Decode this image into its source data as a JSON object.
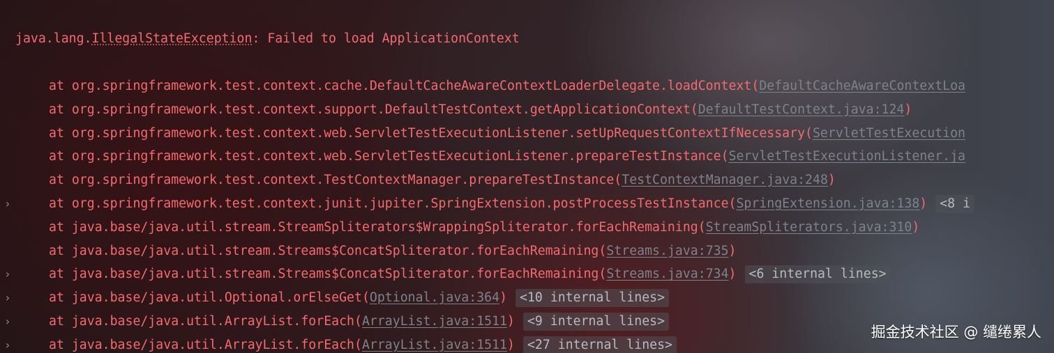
{
  "exception": {
    "class": "java.lang.",
    "class_link": "IllegalStateException",
    "message": ": Failed to load ApplicationContext"
  },
  "frames": [
    {
      "method": "at org.springframework.test.context.cache.DefaultCacheAwareContextLoaderDelegate.loadContext(",
      "link": "DefaultCacheAwareContextLoa",
      "close": "",
      "internal": ""
    },
    {
      "method": "at org.springframework.test.context.support.DefaultTestContext.getApplicationContext(",
      "link": "DefaultTestContext.java:124",
      "close": ")",
      "internal": ""
    },
    {
      "method": "at org.springframework.test.context.web.ServletTestExecutionListener.setUpRequestContextIfNecessary(",
      "link": "ServletTestExecution",
      "close": "",
      "internal": ""
    },
    {
      "method": "at org.springframework.test.context.web.ServletTestExecutionListener.prepareTestInstance(",
      "link": "ServletTestExecutionListener.ja",
      "close": "",
      "internal": ""
    },
    {
      "method": "at org.springframework.test.context.TestContextManager.prepareTestInstance(",
      "link": "TestContextManager.java:248",
      "close": ")",
      "internal": ""
    },
    {
      "method": "at org.springframework.test.context.junit.jupiter.SpringExtension.postProcessTestInstance(",
      "link": "SpringExtension.java:138",
      "close": ")",
      "internal": "<8 i"
    },
    {
      "method": "at java.base/java.util.stream.StreamSpliterators$WrappingSpliterator.forEachRemaining(",
      "link": "StreamSpliterators.java:310",
      "close": ")",
      "internal": ""
    },
    {
      "method": "at java.base/java.util.stream.Streams$ConcatSpliterator.forEachRemaining(",
      "link": "Streams.java:735",
      "close": ")",
      "internal": ""
    },
    {
      "method": "at java.base/java.util.stream.Streams$ConcatSpliterator.forEachRemaining(",
      "link": "Streams.java:734",
      "close": ")",
      "internal": "<6 internal lines>"
    },
    {
      "method": "at java.base/java.util.Optional.orElseGet(",
      "link": "Optional.java:364",
      "close": ")",
      "internal": "<10 internal lines>"
    },
    {
      "method": "at java.base/java.util.ArrayList.forEach(",
      "link": "ArrayList.java:1511",
      "close": ")",
      "internal": "<9 internal lines>"
    },
    {
      "method": "at java.base/java.util.ArrayList.forEach(",
      "link": "ArrayList.java:1511",
      "close": ")",
      "internal": "<27 internal lines>"
    }
  ],
  "fold_icon": "chevron-right-icon",
  "fold_glyph": "›",
  "watermark": "掘金技术社区 @ 缱绻累人",
  "colors": {
    "error_text": "#f46b6f",
    "link_text": "#7e828b",
    "internal_badge_bg": "#505258"
  }
}
